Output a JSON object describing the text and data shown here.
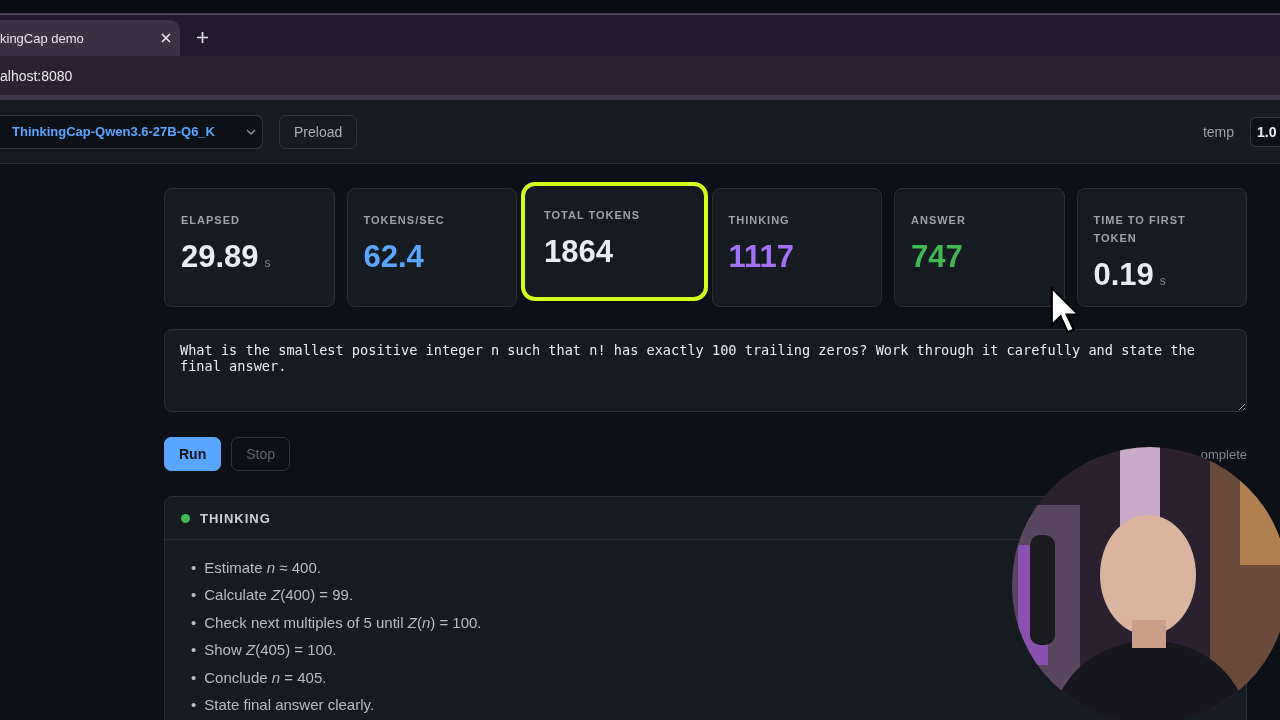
{
  "browser": {
    "tab": {
      "title": "kingCap demo",
      "selected": true
    },
    "address": "alhost:8080"
  },
  "toolbar": {
    "model": "ThinkingCap-Qwen3.6-27B-Q6_K",
    "preload": "Preload",
    "temp_label": "temp",
    "temp_value": "1.0"
  },
  "stats": [
    {
      "label": "ELAPSED",
      "value": "29.89",
      "unit": "s",
      "color": "#e6edf3",
      "highlighted": false
    },
    {
      "label": "TOKENS/SEC",
      "value": "62.4",
      "color": "#58a6ff",
      "highlighted": false
    },
    {
      "label": "TOTAL TOKENS",
      "value": "1864",
      "color": "#e6edf3",
      "highlighted": true
    },
    {
      "label": "THINKING",
      "value": "1117",
      "color": "#a371f7",
      "highlighted": false
    },
    {
      "label": "ANSWER",
      "value": "747",
      "color": "#3fb950",
      "highlighted": false
    },
    {
      "label": "TIME TO FIRST TOKEN",
      "value": "0.19",
      "unit": "s",
      "color": "#e6edf3",
      "highlighted": false
    }
  ],
  "prompt": "What is the smallest positive integer n such that n! has exactly 100 trailing zeros? Work through it carefully and state the final answer.",
  "actions": [
    {
      "label": "Run",
      "disabled": false
    },
    {
      "label": "Stop",
      "disabled": true
    }
  ],
  "status": "omplete",
  "thinking": {
    "title": "THINKING",
    "active": true,
    "bullet": "•",
    "items": [
      "Estimate *n* ≈ 400.",
      "Calculate *Z*(400) = 99.",
      "Check next multiples of 5 until *Z*(*n*) = 100.",
      "Show *Z*(405) = 100.",
      "Conclude *n* = 405.",
      "State final answer clearly."
    ]
  }
}
